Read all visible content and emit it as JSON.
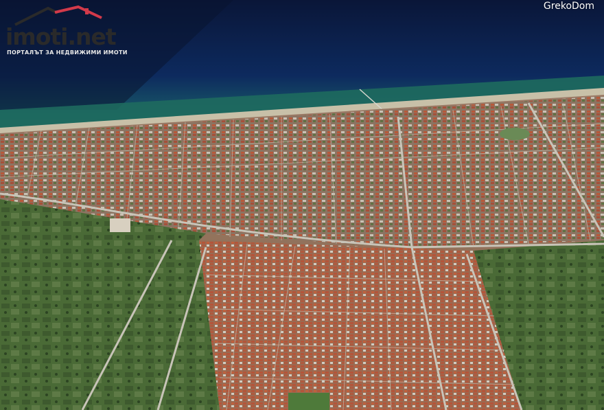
{
  "map": {
    "type": "satellite",
    "view": "oblique"
  },
  "brand": {
    "logo_text": "imoti.net",
    "tagline": "ПОРТАЛЪТ ЗА НЕДВИЖИМИ ИМОТИ",
    "logo_color": "#2a2a2a",
    "accent_color": "#d23a4a"
  },
  "credit": {
    "text": "GrekoDom"
  },
  "colors": {
    "sea_deep": "#0b1e4a",
    "sea_shallow": "#1e6a6a",
    "beach": "#c8c0a8",
    "roofs": "#b0563a",
    "fields": "#4a6a34",
    "roads": "#b8b4a8"
  }
}
